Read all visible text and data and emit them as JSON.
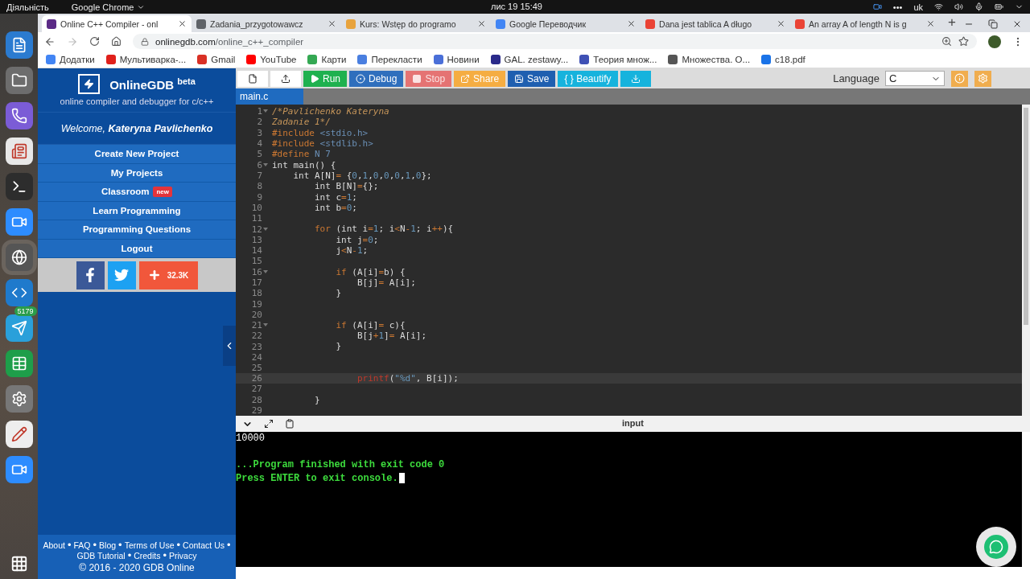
{
  "system_bar": {
    "activities": "Діяльність",
    "app": "Google Chrome",
    "clock": "лис 19  15:49",
    "tray_dots": "•••",
    "keyboard": "uk"
  },
  "dock": {
    "badge": "5179"
  },
  "browser": {
    "tabs": [
      {
        "title": "Online C++ Compiler - onl",
        "selected": true,
        "color": "#5b2a86"
      },
      {
        "title": "Zadania_przygotowawcz",
        "selected": false,
        "color": "#5f6368"
      },
      {
        "title": "Kurs: Wstęp do programo",
        "selected": false,
        "color": "#e8a33d"
      },
      {
        "title": "Google Переводчик",
        "selected": false,
        "color": "#4285f4"
      },
      {
        "title": "Dana jest tablica A długo",
        "selected": false,
        "color": "#ea4335"
      },
      {
        "title": "An array A of length N is g",
        "selected": false,
        "color": "#ea4335"
      }
    ],
    "new_tab": "+",
    "address": {
      "host": "onlinegdb.com",
      "path": "/online_c++_compiler"
    },
    "bookmarks": [
      {
        "label": "Додатки",
        "color": "#4285f4"
      },
      {
        "label": "Мультиварка-...",
        "color": "#e0201b"
      },
      {
        "label": "Gmail",
        "color": "#d93025"
      },
      {
        "label": "YouTube",
        "color": "#ff0000"
      },
      {
        "label": "Карти",
        "color": "#34a853"
      },
      {
        "label": "Перекласти",
        "color": "#4a7fe0"
      },
      {
        "label": "Новини",
        "color": "#4a6fd8"
      },
      {
        "label": "GAL. zestawy...",
        "color": "#2a2a8a"
      },
      {
        "label": "Теория множ...",
        "color": "#3f51b5"
      },
      {
        "label": "Множества. О...",
        "color": "#555555"
      },
      {
        "label": "c18.pdf",
        "color": "#1a73e8"
      }
    ]
  },
  "sidebar": {
    "brand": "OnlineGDB",
    "brand_tag": "beta",
    "subtitle": "online compiler and debugger for c/c++",
    "welcome": "Welcome, **Kateryna Pavlichenko**",
    "menu": [
      {
        "label": "Create New Project"
      },
      {
        "label": "My Projects"
      },
      {
        "label": "Classroom",
        "badge": "new"
      },
      {
        "label": "Learn Programming"
      },
      {
        "label": "Programming Questions"
      },
      {
        "label": "Logout"
      }
    ],
    "share_count": "32.3K",
    "footer": [
      [
        {
          "kind": "link",
          "text": "About"
        },
        {
          "kind": "bullet",
          "text": "•"
        },
        {
          "kind": "link",
          "text": "FAQ"
        },
        {
          "kind": "bullet",
          "text": "•"
        },
        {
          "kind": "link",
          "text": "Blog"
        },
        {
          "kind": "bullet",
          "text": "•"
        },
        {
          "kind": "link",
          "text": "Terms of Use"
        },
        {
          "kind": "bullet",
          "text": "•"
        },
        {
          "kind": "link",
          "text": "Contact Us"
        },
        {
          "kind": "bullet",
          "text": "•"
        }
      ],
      [
        {
          "kind": "link",
          "text": "GDB Tutorial"
        },
        {
          "kind": "bullet",
          "text": "•"
        },
        {
          "kind": "link",
          "text": "Credits"
        },
        {
          "kind": "bullet",
          "text": "•"
        },
        {
          "kind": "link",
          "text": "Privacy"
        }
      ]
    ],
    "copyright": "© 2016 - 2020 GDB Online"
  },
  "toolbar": {
    "buttons": [
      {
        "kind": "new-file",
        "color": "#ffffff",
        "disabled": false
      },
      {
        "kind": "upload",
        "color": "#ffffff",
        "disabled": false
      },
      {
        "kind": "run",
        "label": "Run",
        "color": "#1fb14f",
        "disabled": false
      },
      {
        "kind": "debug",
        "label": "Debug",
        "color": "#2f6fbd",
        "disabled": false
      },
      {
        "kind": "stop",
        "label": "Stop",
        "color": "#e57373",
        "disabled": true
      },
      {
        "kind": "share",
        "label": "Share",
        "color": "#f5ad42",
        "disabled": false
      },
      {
        "kind": "save",
        "label": "Save",
        "color": "#1f5fb0",
        "disabled": false
      },
      {
        "kind": "beautify",
        "label": "{ } Beautify",
        "color": "#16b3dd",
        "disabled": false
      },
      {
        "kind": "download",
        "color": "#16b3dd",
        "disabled": false
      }
    ],
    "language_label": "Language",
    "language": "C"
  },
  "file_tabs": [
    {
      "name": "main.c",
      "selected": true
    }
  ],
  "editor": {
    "lines": [
      {
        "number": "1",
        "foldable": true,
        "tokens": [
          {
            "kind": "comment",
            "text": "/*Pavlichenko Kateryna"
          }
        ]
      },
      {
        "number": "2",
        "foldable": false,
        "tokens": [
          {
            "kind": "comment",
            "text": "Zadanie 1*/"
          }
        ]
      },
      {
        "number": "3",
        "foldable": false,
        "tokens": [
          {
            "kind": "directive",
            "text": "#include "
          },
          {
            "kind": "header",
            "text": "<stdio.h>"
          }
        ]
      },
      {
        "number": "4",
        "foldable": false,
        "tokens": [
          {
            "kind": "directive",
            "text": "#include "
          },
          {
            "kind": "header",
            "text": "<stdlib.h>"
          }
        ]
      },
      {
        "number": "5",
        "foldable": false,
        "tokens": [
          {
            "kind": "directive",
            "text": "#define "
          },
          {
            "kind": "header",
            "text": "N 7"
          }
        ]
      },
      {
        "number": "6",
        "foldable": true,
        "tokens": [
          {
            "kind": "plain",
            "text": "int main() {"
          }
        ]
      },
      {
        "number": "7",
        "foldable": false,
        "tokens": [
          {
            "kind": "plain",
            "text": "    int A[N]"
          },
          {
            "kind": "op",
            "text": "="
          },
          {
            "kind": "plain",
            "text": " {"
          },
          {
            "kind": "number",
            "text": "0"
          },
          {
            "kind": "plain",
            "text": ","
          },
          {
            "kind": "number",
            "text": "1"
          },
          {
            "kind": "plain",
            "text": ","
          },
          {
            "kind": "number",
            "text": "0"
          },
          {
            "kind": "plain",
            "text": ","
          },
          {
            "kind": "number",
            "text": "0"
          },
          {
            "kind": "plain",
            "text": ","
          },
          {
            "kind": "number",
            "text": "0"
          },
          {
            "kind": "plain",
            "text": ","
          },
          {
            "kind": "number",
            "text": "1"
          },
          {
            "kind": "plain",
            "text": ","
          },
          {
            "kind": "number",
            "text": "0"
          },
          {
            "kind": "plain",
            "text": "};"
          }
        ]
      },
      {
        "number": "8",
        "foldable": false,
        "tokens": [
          {
            "kind": "plain",
            "text": "        int B[N]"
          },
          {
            "kind": "op",
            "text": "="
          },
          {
            "kind": "plain",
            "text": "{};"
          }
        ]
      },
      {
        "number": "9",
        "foldable": false,
        "tokens": [
          {
            "kind": "plain",
            "text": "        int c"
          },
          {
            "kind": "op",
            "text": "="
          },
          {
            "kind": "number",
            "text": "1"
          },
          {
            "kind": "plain",
            "text": ";"
          }
        ]
      },
      {
        "number": "10",
        "foldable": false,
        "tokens": [
          {
            "kind": "plain",
            "text": "        int b"
          },
          {
            "kind": "op",
            "text": "="
          },
          {
            "kind": "number",
            "text": "0"
          },
          {
            "kind": "plain",
            "text": ";"
          }
        ]
      },
      {
        "number": "11",
        "foldable": false
      },
      {
        "number": "12",
        "foldable": true,
        "tokens": [
          {
            "kind": "keyword",
            "text": "        for"
          },
          {
            "kind": "plain",
            "text": " (int i"
          },
          {
            "kind": "op",
            "text": "="
          },
          {
            "kind": "number",
            "text": "1"
          },
          {
            "kind": "plain",
            "text": "; i"
          },
          {
            "kind": "op",
            "text": "<"
          },
          {
            "kind": "plain",
            "text": "N"
          },
          {
            "kind": "op",
            "text": "-"
          },
          {
            "kind": "number",
            "text": "1"
          },
          {
            "kind": "plain",
            "text": "; i"
          },
          {
            "kind": "op",
            "text": "++"
          },
          {
            "kind": "plain",
            "text": "){"
          }
        ]
      },
      {
        "number": "13",
        "foldable": false,
        "tokens": [
          {
            "kind": "plain",
            "text": "            int j"
          },
          {
            "kind": "op",
            "text": "="
          },
          {
            "kind": "number",
            "text": "0"
          },
          {
            "kind": "plain",
            "text": ";"
          }
        ]
      },
      {
        "number": "14",
        "foldable": false,
        "tokens": [
          {
            "kind": "plain",
            "text": "            j"
          },
          {
            "kind": "op",
            "text": "<"
          },
          {
            "kind": "plain",
            "text": "N"
          },
          {
            "kind": "op",
            "text": "-"
          },
          {
            "kind": "number",
            "text": "1"
          },
          {
            "kind": "plain",
            "text": ";"
          }
        ]
      },
      {
        "number": "15",
        "foldable": false
      },
      {
        "number": "16",
        "foldable": true,
        "tokens": [
          {
            "kind": "keyword",
            "text": "            if"
          },
          {
            "kind": "plain",
            "text": " (A[i]"
          },
          {
            "kind": "op",
            "text": "="
          },
          {
            "kind": "plain",
            "text": "b) {"
          }
        ]
      },
      {
        "number": "17",
        "foldable": false,
        "tokens": [
          {
            "kind": "plain",
            "text": "                B[j]"
          },
          {
            "kind": "op",
            "text": "="
          },
          {
            "kind": "plain",
            "text": " A[i];"
          }
        ]
      },
      {
        "number": "18",
        "foldable": false,
        "tokens": [
          {
            "kind": "plain",
            "text": "            }"
          }
        ]
      },
      {
        "number": "19",
        "foldable": false
      },
      {
        "number": "20",
        "foldable": false
      },
      {
        "number": "21",
        "foldable": true,
        "tokens": [
          {
            "kind": "keyword",
            "text": "            if"
          },
          {
            "kind": "plain",
            "text": " (A[i]"
          },
          {
            "kind": "op",
            "text": "="
          },
          {
            "kind": "plain",
            "text": " c){"
          }
        ]
      },
      {
        "number": "22",
        "foldable": false,
        "tokens": [
          {
            "kind": "plain",
            "text": "                B[j"
          },
          {
            "kind": "op",
            "text": "+"
          },
          {
            "kind": "number",
            "text": "1"
          },
          {
            "kind": "plain",
            "text": "]"
          },
          {
            "kind": "op",
            "text": "="
          },
          {
            "kind": "plain",
            "text": " A[i];"
          }
        ]
      },
      {
        "number": "23",
        "foldable": false,
        "tokens": [
          {
            "kind": "plain",
            "text": "            }"
          }
        ]
      },
      {
        "number": "24",
        "foldable": false
      },
      {
        "number": "25",
        "foldable": false
      },
      {
        "number": "26",
        "foldable": false,
        "active": true,
        "tokens": [
          {
            "kind": "func",
            "text": "                printf"
          },
          {
            "kind": "plain",
            "text": "("
          },
          {
            "kind": "string",
            "text": "\"%d\""
          },
          {
            "kind": "plain",
            "text": ", B[i]);"
          }
        ]
      },
      {
        "number": "27",
        "foldable": false
      },
      {
        "number": "28",
        "foldable": false,
        "tokens": [
          {
            "kind": "plain",
            "text": "        }"
          }
        ]
      },
      {
        "number": "29",
        "foldable": false
      }
    ]
  },
  "console": {
    "title": "input",
    "output": [
      {
        "kind": "stdout",
        "text": "10000"
      },
      {
        "kind": "blank"
      },
      {
        "kind": "status",
        "text": "...Program finished with exit code 0"
      },
      {
        "kind": "prompt",
        "text": "Press ENTER to exit console."
      }
    ]
  }
}
